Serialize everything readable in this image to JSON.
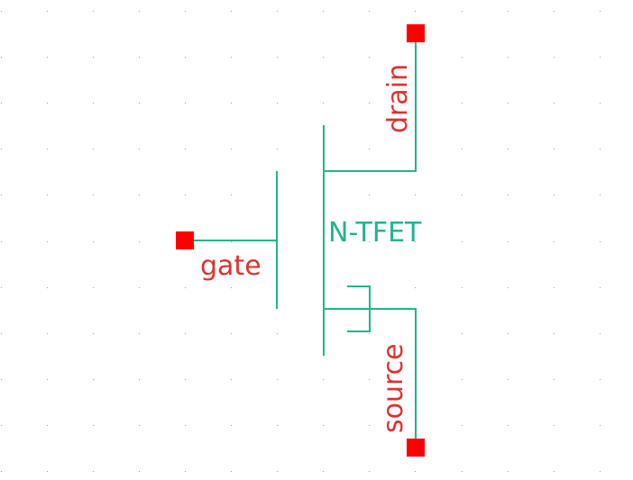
{
  "schematic": {
    "device_name": "N-TFET",
    "pins": {
      "gate": "gate",
      "drain": "drain",
      "source": "source"
    }
  },
  "colors": {
    "background": "#ffffff",
    "wire": "#1fb58f",
    "pin": "#ff0000",
    "label": "#e03030",
    "grid": "#9a9a9a"
  }
}
